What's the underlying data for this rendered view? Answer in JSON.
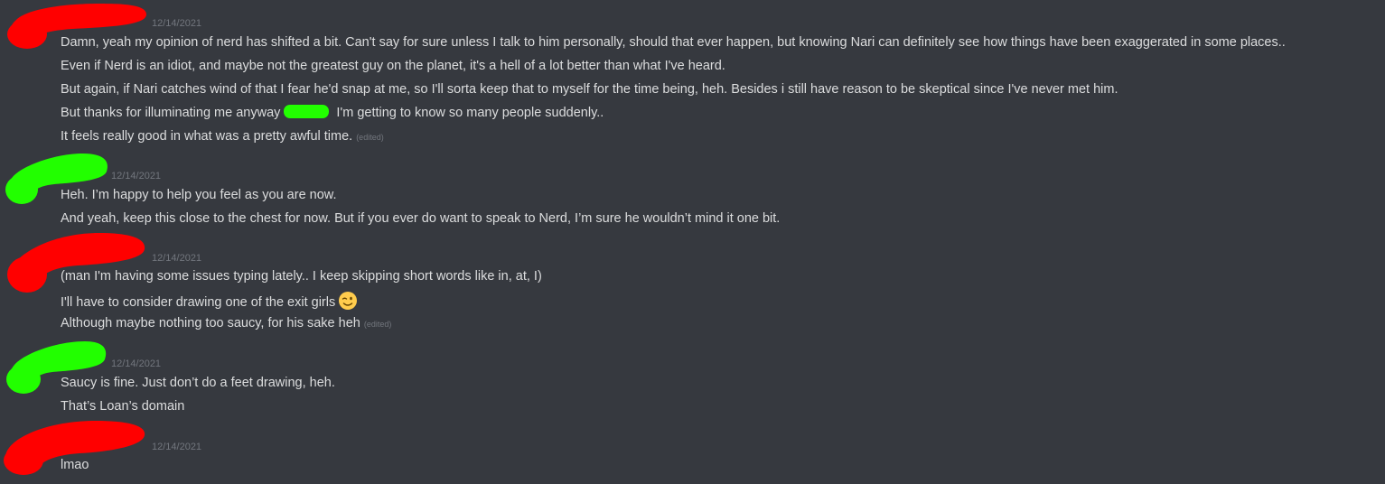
{
  "colors": {
    "background": "#36393f",
    "message_text": "#dcddde",
    "timestamp": "#72767d",
    "redaction_red": "#ff0000",
    "redaction_green": "#22ff00"
  },
  "messages": [
    {
      "author_redaction_color": "red",
      "timestamp": "12/14/2021",
      "lines": [
        {
          "text": "Damn, yeah my opinion of nerd has shifted a bit. Can't say for sure unless I talk to him personally, should that ever happen, but knowing Nari can definitely see how things have been exaggerated in some places.."
        },
        {
          "text": "Even if Nerd is an idiot, and maybe not the greatest guy on the planet, it's a hell of a lot better than what I've heard."
        },
        {
          "text": "But again, if Nari catches wind of that I fear he'd snap at me, so I'll sorta keep that to myself for the time being, heh. Besides i still have reason to be skeptical since I've never met him."
        },
        {
          "text_before": "But thanks for illuminating me anyway",
          "text_after": " I'm getting to know so many people suddenly.."
        },
        {
          "text": "It feels really good in what was a pretty awful time.",
          "edited": "(edited)"
        }
      ]
    },
    {
      "author_redaction_color": "green",
      "timestamp": "12/14/2021",
      "lines": [
        {
          "text": "Heh. I’m happy to help you feel as you are now."
        },
        {
          "text": "And yeah, keep this close to the chest for now. But if you ever do want to speak to Nerd, I’m sure he wouldn’t mind it one bit."
        }
      ]
    },
    {
      "author_redaction_color": "red",
      "timestamp": "12/14/2021",
      "lines": [
        {
          "text": "(man I'm having some issues typing lately.. I keep skipping short words like in, at, I)"
        },
        {
          "text": "I'll have to consider drawing one of the exit girls",
          "emoji": "winking-face"
        },
        {
          "text": "Although maybe nothing too saucy, for his sake heh",
          "edited": "(edited)"
        }
      ]
    },
    {
      "author_redaction_color": "green",
      "timestamp": "12/14/2021",
      "lines": [
        {
          "text": "Saucy is fine. Just don’t do a feet drawing, heh."
        },
        {
          "text": "That’s Loan’s domain"
        }
      ]
    },
    {
      "author_redaction_color": "red",
      "timestamp": "12/14/2021",
      "lines": [
        {
          "text": "lmao"
        }
      ]
    }
  ]
}
